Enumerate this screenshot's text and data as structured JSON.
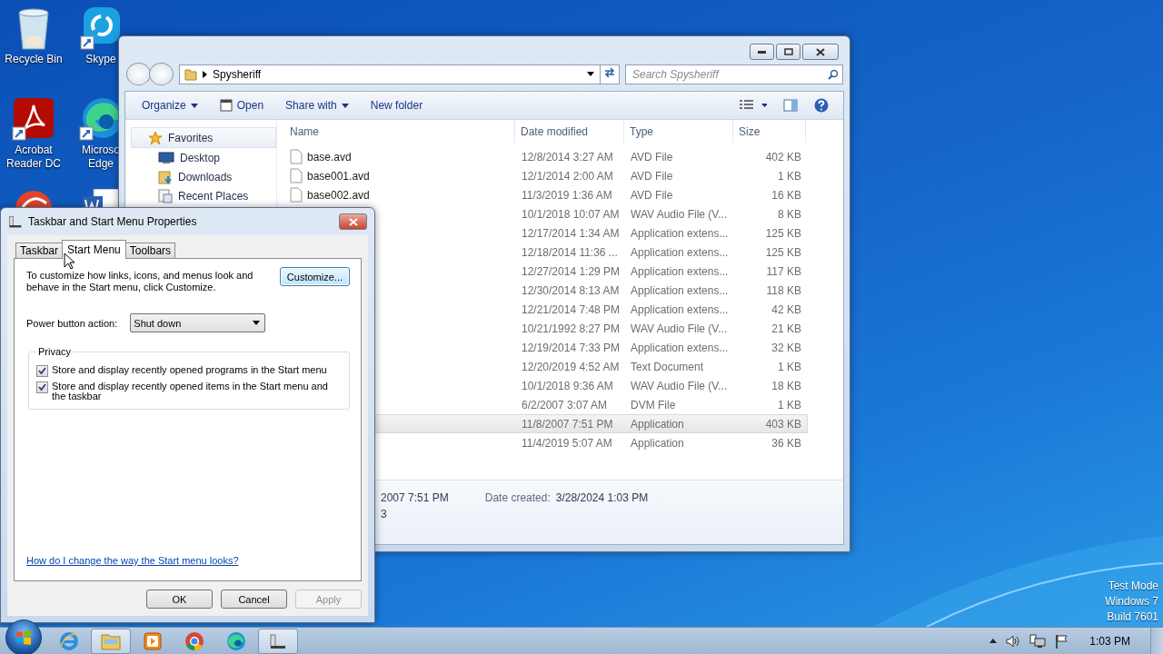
{
  "desktop": {
    "icons": [
      {
        "kind": "recycle",
        "label": [
          "Recycle Bin"
        ]
      },
      {
        "kind": "skype",
        "label": [
          "Skype"
        ]
      },
      {
        "kind": "acrobat",
        "label": [
          "Acrobat",
          "Reader DC"
        ]
      },
      {
        "kind": "edge",
        "label": [
          "Microso",
          "Edge"
        ]
      },
      {
        "kind": "redcircle"
      },
      {
        "kind": "word"
      }
    ],
    "os_notice": [
      "Test Mode",
      "Windows 7",
      "Build 7601"
    ]
  },
  "explorer": {
    "breadcrumb": "Spysheriff",
    "search_placeholder": "Search Spysheriff",
    "toolbar": [
      {
        "kind": "menu",
        "label": "Organize"
      },
      {
        "kind": "open",
        "label": "Open"
      },
      {
        "kind": "menu",
        "label": "Share with"
      },
      {
        "kind": "plain",
        "label": "New folder"
      }
    ],
    "nav": [
      {
        "kind": "header",
        "label": "Favorites"
      },
      {
        "kind": "desktop",
        "label": "Desktop"
      },
      {
        "kind": "downloads",
        "label": "Downloads"
      },
      {
        "kind": "recent",
        "label": "Recent Places"
      }
    ],
    "columns": [
      "Name",
      "Date modified",
      "Type",
      "Size"
    ],
    "rows": [
      {
        "name": "base.avd",
        "date": "12/8/2014 3:27 AM",
        "type": "AVD File",
        "size": "402 KB",
        "selected": false
      },
      {
        "name": "base001.avd",
        "date": "12/1/2014 2:00 AM",
        "type": "AVD File",
        "size": "1 KB",
        "selected": false
      },
      {
        "name": "base002.avd",
        "date": "11/3/2019 1:36 AM",
        "type": "AVD File",
        "size": "16 KB",
        "selected": false
      },
      {
        "date": "10/1/2018 10:07 AM",
        "type": "WAV Audio File (V...",
        "size": "8 KB",
        "selected": false
      },
      {
        "date": "12/17/2014 1:34 AM",
        "type": "Application extens...",
        "size": "125 KB",
        "selected": false
      },
      {
        "date": "12/18/2014 11:36 ...",
        "type": "Application extens...",
        "size": "125 KB",
        "selected": false
      },
      {
        "date": "12/27/2014 1:29 PM",
        "type": "Application extens...",
        "size": "117 KB",
        "selected": false
      },
      {
        "date": "12/30/2014 8:13 AM",
        "type": "Application extens...",
        "size": "118 KB",
        "selected": false
      },
      {
        "date": "12/21/2014 7:48 PM",
        "type": "Application extens...",
        "size": "42 KB",
        "selected": false
      },
      {
        "date": "10/21/1992 8:27 PM",
        "type": "WAV Audio File (V...",
        "size": "21 KB",
        "selected": false
      },
      {
        "date": "12/19/2014 7:33 PM",
        "type": "Application extens...",
        "size": "32 KB",
        "selected": false
      },
      {
        "date": "12/20/2019 4:52 AM",
        "type": "Text Document",
        "size": "1 KB",
        "selected": false
      },
      {
        "date": "10/1/2018 9:36 AM",
        "type": "WAV Audio File (V...",
        "size": "18 KB",
        "selected": false
      },
      {
        "date": "6/2/2007 3:07 AM",
        "type": "DVM File",
        "size": "1 KB",
        "selected": false
      },
      {
        "date": "11/8/2007 7:51 PM",
        "type": "Application",
        "size": "403 KB",
        "selected": true
      },
      {
        "date": "11/4/2019 5:07 AM",
        "type": "Application",
        "size": "36 KB",
        "selected": false
      }
    ],
    "details": {
      "modified_fragment": "2007 7:51 PM",
      "size_fragment": "3",
      "created_label": "Date created:",
      "created_value": "3/28/2024 1:03 PM"
    }
  },
  "dialog": {
    "title": "Taskbar and Start Menu Properties",
    "tabs": [
      {
        "label": "Taskbar",
        "selected": false
      },
      {
        "label": "Start Menu",
        "selected": true
      },
      {
        "label": "Toolbars",
        "selected": false
      }
    ],
    "description": "To customize how links, icons, and menus look and behave in the Start menu, click Customize.",
    "customize_button": "Customize...",
    "power_label": "Power button action:",
    "power_value": "Shut down",
    "privacy_title": "Privacy",
    "privacy": [
      {
        "label": "Store and display recently opened programs in the Start menu",
        "checked": true
      },
      {
        "label": "Store and display recently opened items in the Start menu and the taskbar",
        "checked": true
      }
    ],
    "help_link": "How do I change the way the Start menu looks?",
    "buttons": [
      {
        "label": "OK",
        "disabled": false
      },
      {
        "label": "Cancel",
        "disabled": false
      },
      {
        "label": "Apply",
        "disabled": true
      }
    ]
  },
  "taskbar": {
    "apps": [
      {
        "kind": "ie",
        "active": false
      },
      {
        "kind": "explorer",
        "active": true
      },
      {
        "kind": "media",
        "active": false
      },
      {
        "kind": "chrome",
        "active": false
      },
      {
        "kind": "edge",
        "active": false
      },
      {
        "kind": "props",
        "active": true
      }
    ],
    "clock": "1:03 PM"
  }
}
